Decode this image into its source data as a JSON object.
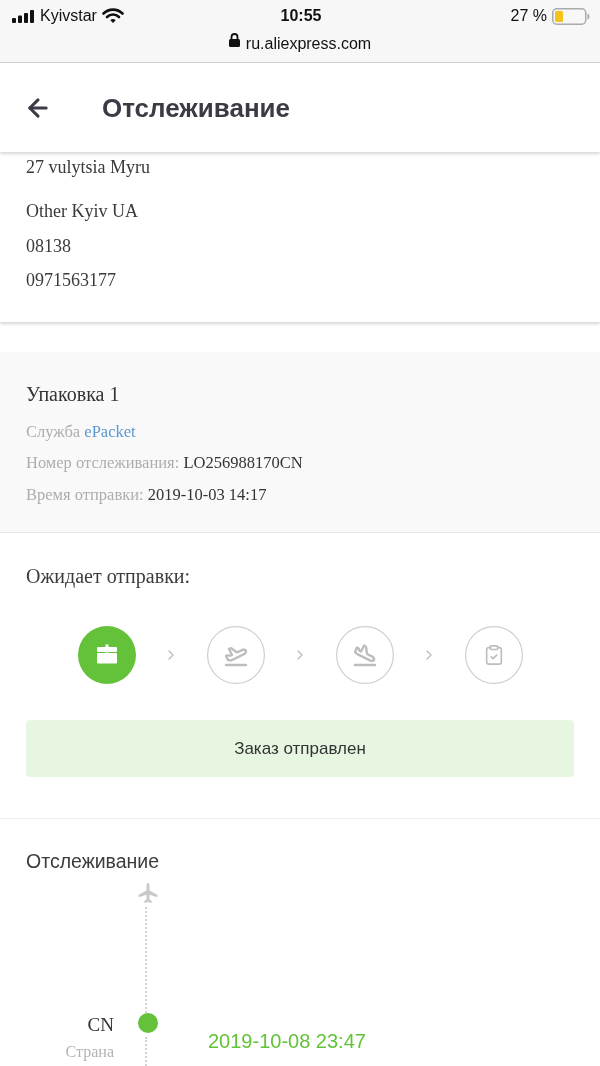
{
  "status_bar": {
    "carrier": "Kyivstar",
    "time": "10:55",
    "battery": "27 %"
  },
  "browser": {
    "url": "ru.aliexpress.com"
  },
  "header": {
    "title": "Отслеживание"
  },
  "address": {
    "lines": [
      "27 vulytsia Myru",
      "Other Kyiv UA",
      "08138",
      "0971563177"
    ]
  },
  "package": {
    "title": "Упаковка 1",
    "service_label": "Служба",
    "service": "ePacket",
    "tracking_label": "Номер отслеживания:",
    "tracking_number": "LO256988170CN",
    "sent_label": "Время отправки:",
    "sent_time": "2019-10-03 14:17"
  },
  "status": {
    "title": "Ожидает отправки:",
    "steps": [
      {
        "kind": "package",
        "done": true
      },
      {
        "kind": "departure",
        "done": false
      },
      {
        "kind": "arrival",
        "done": false
      },
      {
        "kind": "received",
        "done": false
      }
    ],
    "banner": "Заказ отправлен"
  },
  "tracking": {
    "title": "Отслеживание",
    "events": [
      {
        "region": "CN",
        "region_label": "Страна",
        "time": "2019-10-08 23:47",
        "current": true
      }
    ]
  }
}
